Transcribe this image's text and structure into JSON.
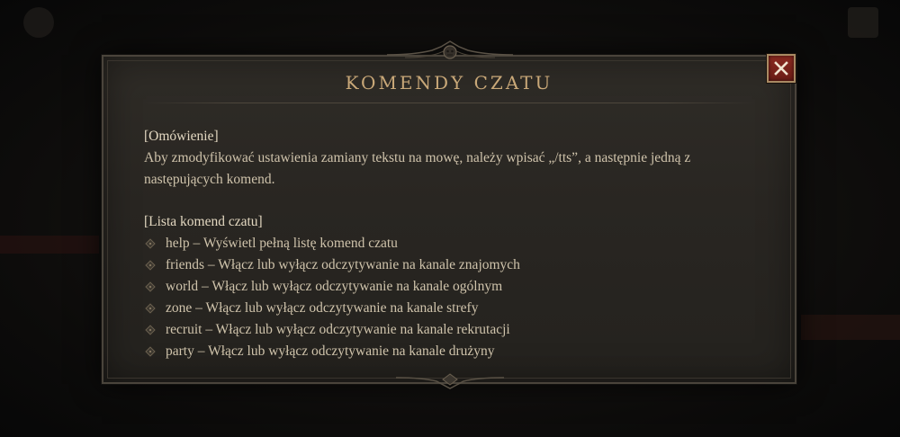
{
  "dialog": {
    "title": "Komendy czatu",
    "close_icon": "close-x-icon",
    "overview_heading": "[Omówienie]",
    "overview_text_line1": "Aby zmodyfikować ustawienia zamiany tekstu na mowę, należy wpisać „/tts”, a następnie jedną z",
    "overview_text_line2": "następujących komend.",
    "list_heading": "[Lista komend czatu]",
    "commands": [
      {
        "text": "help – Wyświetl pełną listę komend czatu"
      },
      {
        "text": "friends – Włącz lub wyłącz odczytywanie na kanale znajomych"
      },
      {
        "text": "world – Włącz lub wyłącz odczytywanie na kanale ogólnym"
      },
      {
        "text": "zone – Włącz lub wyłącz odczytywanie na kanale strefy"
      },
      {
        "text": "recruit – Włącz lub wyłącz odczytywanie na kanale rekrutacji"
      },
      {
        "text": "party – Włącz lub wyłącz odczytywanie na kanale drużyny"
      }
    ]
  },
  "colors": {
    "title": "#c9a878",
    "body_text": "#cfc3ab",
    "close_button": "#7a231b",
    "panel": "#2b2824"
  }
}
